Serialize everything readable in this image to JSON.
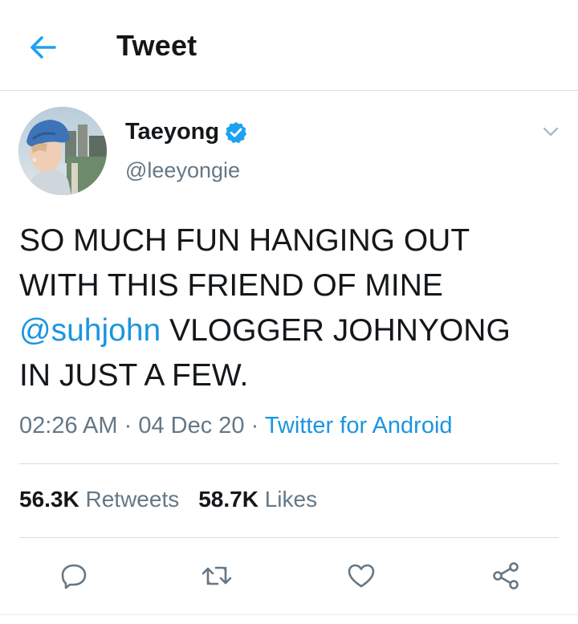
{
  "header": {
    "title": "Tweet",
    "back_icon": "arrow-left-icon"
  },
  "author": {
    "display_name": "Taeyong",
    "handle": "@leeyongie",
    "verified": true
  },
  "tweet": {
    "line1": "SO MUCH FUN HANGING OUT",
    "line2": "WITH THIS FRIEND OF MINE",
    "mention": "@suhjohn",
    "line3_rest": " VLOGGER JOHNYONG",
    "line4": "IN JUST A FEW."
  },
  "meta": {
    "time": "02:26 AM",
    "date": "04 Dec 20",
    "separator": "·",
    "source": "Twitter for Android"
  },
  "stats": {
    "retweets_count": "56.3K",
    "retweets_label": "Retweets",
    "likes_count": "58.7K",
    "likes_label": "Likes"
  },
  "actions": [
    "reply-icon",
    "retweet-icon",
    "like-icon",
    "share-icon"
  ],
  "colors": {
    "accent": "#1b95e0",
    "text": "#14171a",
    "secondary": "#657786",
    "divider": "#d7dde2"
  }
}
